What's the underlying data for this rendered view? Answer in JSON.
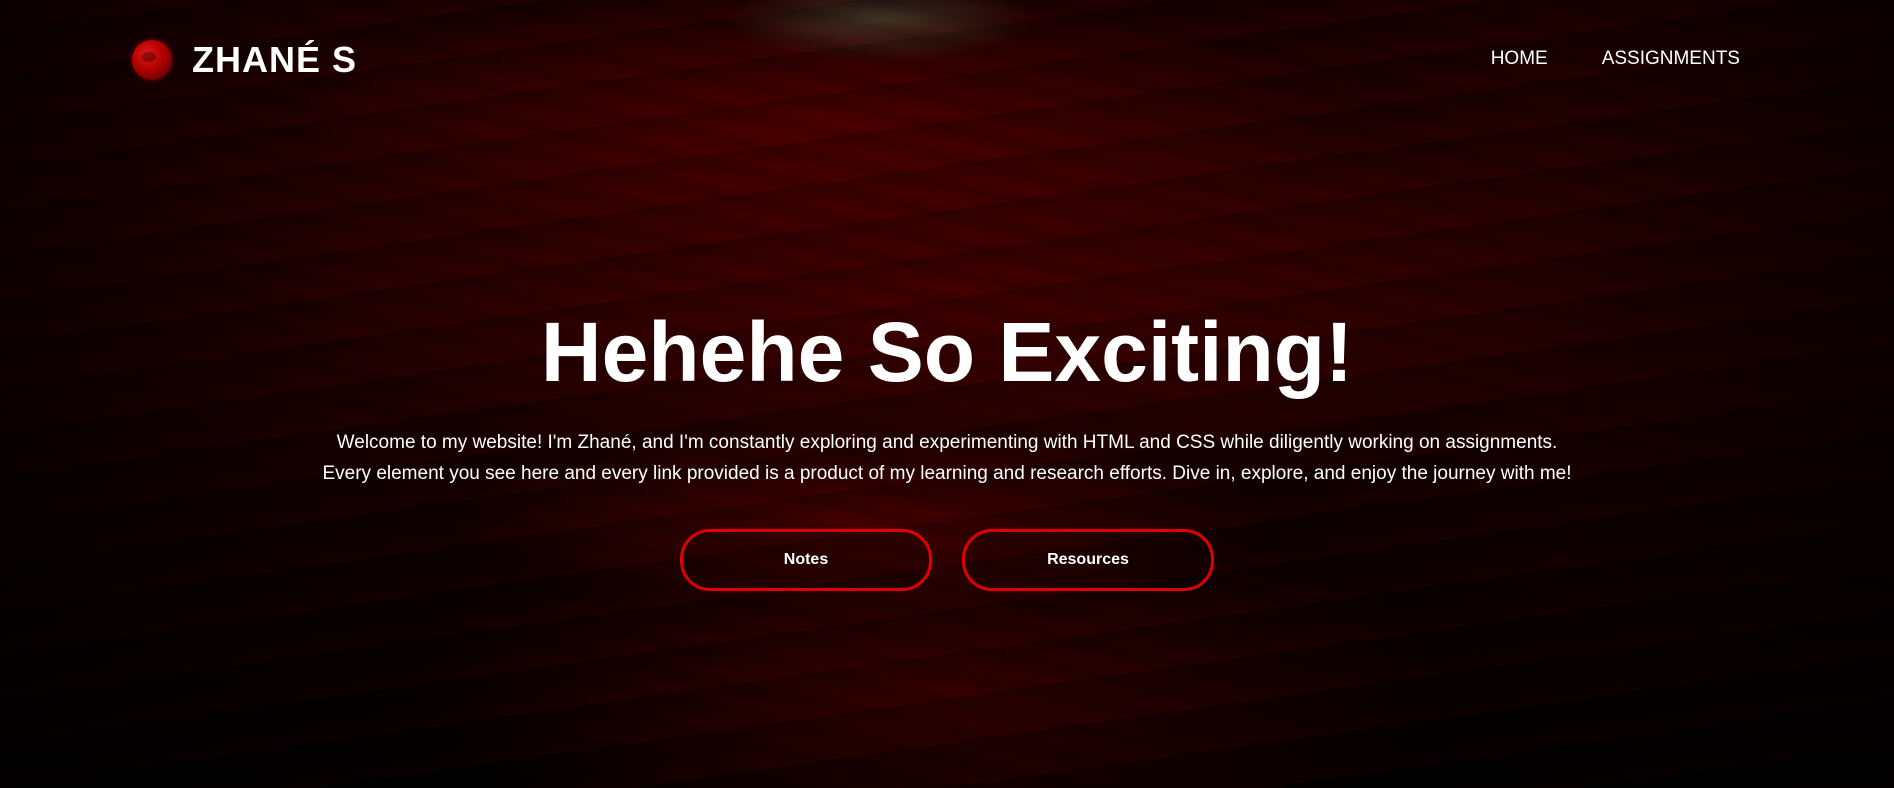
{
  "brand": {
    "name": "ZHANÉ S",
    "logo_icon": "blood-moon-icon",
    "logo_color": "#b00000"
  },
  "nav": {
    "items": [
      {
        "label": "HOME"
      },
      {
        "label": "ASSIGNMENTS"
      }
    ]
  },
  "hero": {
    "title": "Hehehe So Exciting!",
    "intro_line_1": "Welcome to my website! I'm Zhané, and I'm constantly exploring and experimenting with HTML and CSS while diligently working on assignments.",
    "intro_line_2": "Every element you see here and every link provided is a product of my learning and research efforts. Dive in, explore, and enjoy the journey with me!",
    "buttons": [
      {
        "label": "Notes"
      },
      {
        "label": "Resources"
      }
    ]
  },
  "colors": {
    "accent": "#e00000",
    "text": "#ffffff",
    "background": "#120000"
  }
}
